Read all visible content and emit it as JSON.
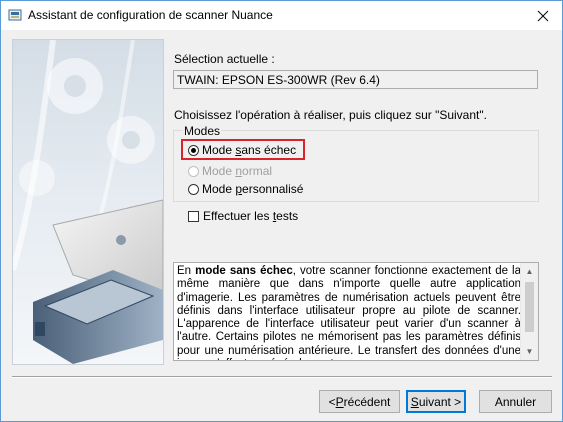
{
  "window": {
    "title": "Assistant de configuration de scanner Nuance"
  },
  "selection": {
    "label": "Sélection actuelle :",
    "value": "TWAIN: EPSON ES-300WR (Rev 6.4)"
  },
  "instruction": "Choisissez l'opération à réaliser, puis cliquez sur \"Suivant\".",
  "modes": {
    "legend": "Modes",
    "options": [
      {
        "pre": "Mode ",
        "key": "s",
        "post": "ans échec",
        "checked": true,
        "enabled": true
      },
      {
        "pre": "Mode ",
        "key": "n",
        "post": "ormal",
        "checked": false,
        "enabled": false
      },
      {
        "pre": "Mode ",
        "key": "p",
        "post": "ersonnalisé",
        "checked": false,
        "enabled": true
      }
    ]
  },
  "tests": {
    "pre": "Effectuer les ",
    "key": "t",
    "post": "ests",
    "checked": false
  },
  "description": {
    "lead": "En ",
    "bold": "mode sans échec",
    "rest": ", votre scanner fonctionne exactement de la même manière que dans n'importe quelle autre application d'imagerie. Les paramètres de numérisation actuels peuvent être définis dans l'interface utilisateur propre au pilote de scanner. L'apparence de l'interface utilisateur peut varier d'un scanner à l'autre. Certains pilotes ne mémorisent pas les paramètres définis pour une numérisation antérieure. Le transfert des données d'une image s'effectue généralement au moyen"
  },
  "buttons": {
    "back": {
      "pre": "< ",
      "key": "P",
      "post": "récédent"
    },
    "next": {
      "pre": "",
      "key": "S",
      "post": "uivant >"
    },
    "cancel": "Annuler"
  },
  "icons": {
    "close": "close-icon",
    "app": "nuance-scanner-icon",
    "scroll_up": "scroll-up-icon",
    "scroll_down": "scroll-down-icon"
  },
  "colors": {
    "highlight": "#d9232d",
    "default_button_border": "#0078d7"
  }
}
